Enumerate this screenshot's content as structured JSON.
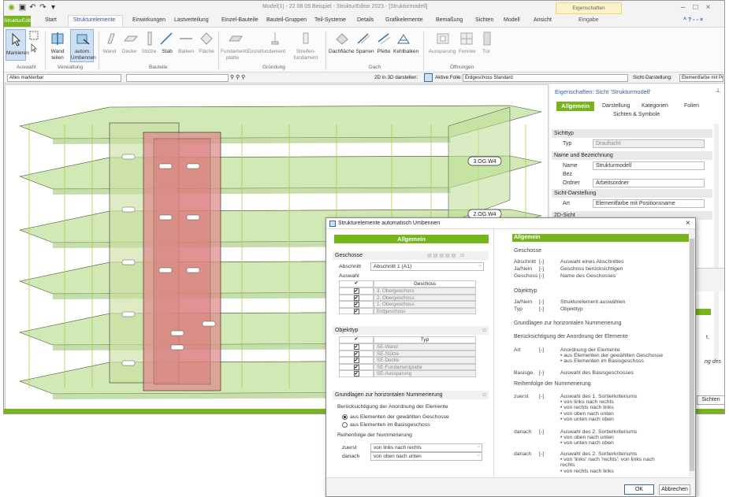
{
  "titlebar": {
    "title": "Model(1) - 22 08 09 Beispiel - StrukturEditor 2023 - [Strukturmodell]",
    "context_tab": "Eigenschaften",
    "context_sub": "Eingabe"
  },
  "app_button": "StrukturEditor",
  "tabs": [
    "Start",
    "Strukturelemente",
    "Einwirkungen",
    "Lastverteilung",
    "Einzel-Bauteile",
    "Bauteil-Gruppen",
    "Teil-Systeme",
    "Details",
    "Grafikelemente",
    "Bemaßung",
    "Sichten",
    "Modell",
    "Ansicht"
  ],
  "ribbon": {
    "auswahl": {
      "group": "Auswahl",
      "markieren": "Markieren"
    },
    "verwaltung": {
      "group": "Verwaltung",
      "wand_teilen": "Wand teilen",
      "umbenennen": "autom. Umbennen"
    },
    "bauteile": {
      "group": "Bauteile",
      "items": [
        "Wand",
        "Decke",
        "Stütze",
        "Stab",
        "Balken",
        "Fläche"
      ]
    },
    "gruendung": {
      "group": "Gründung",
      "items": [
        "Fundament-platte",
        "Einzelfundament",
        "Streifen-fundament"
      ]
    },
    "dach": {
      "group": "Dach",
      "items": [
        "Dachfläche",
        "Sparren",
        "Pfette",
        "Kehlbalken"
      ]
    },
    "oeffnungen": {
      "group": "Öffnungen",
      "items": [
        "Aussparung",
        "Fenster",
        "Tür"
      ]
    }
  },
  "toolbar2": {
    "filter": "Alles markierbar",
    "darstellen": "2D in 3D darstellen:",
    "aktive_folie": "Aktive Folie:",
    "folie_value": "Erdgeschoss  Standard",
    "sicht_label": "Sicht-Darstellung:",
    "sicht_value": "Elementfarbe mit Positions"
  },
  "viewport": {
    "labels": [
      "3.OG.W4",
      "2.OG.W4"
    ]
  },
  "props": {
    "title": "Eigenschaften: Sicht 'Strukturmodell'",
    "tabs": [
      "Allgemein",
      "Darstellung",
      "Kategorien",
      "Folien",
      "Sichten & Symbole"
    ],
    "sichttyp": {
      "section": "Sichttyp",
      "typ_label": "Typ",
      "typ_value": "Draufsicht"
    },
    "name": {
      "section": "Name und Bezeichnung",
      "name_label": "Name",
      "name_value": "Strukturmodell",
      "bez_label": "Bez",
      "ordner_label": "Ordner",
      "ordner_value": "Arbeitsordner"
    },
    "sicht": {
      "section": "Sicht-Darstellung",
      "art_label": "Art",
      "art_value": "Elementfarbe mit Positionsname"
    },
    "sicht2d": "2D-Sicht",
    "overflow": [
      "Sichten",
      "t,",
      "ng des"
    ]
  },
  "dialog": {
    "title": "Strukturelemente automatisch Umbennen",
    "tab": "Allgemein",
    "geschosse": {
      "section": "Geschosse",
      "abschnitt_label": "Abschnitt",
      "abschnitt_value": "Abschnitt 1 (A1)",
      "auswahl_label": "Auswahl",
      "col": "Geschoss",
      "rows": [
        "3. Obergeschoss",
        "2. Obergeschoss",
        "1. Obergeschoss",
        "Erdgeschoss"
      ]
    },
    "objekttyp": {
      "section": "Objekttyp",
      "col": "Typ",
      "rows": [
        "SE-Wand",
        "SE-Stütze",
        "SE-Decke",
        "SE-Fundamentplatte",
        "SE-Aussparung"
      ]
    },
    "nummerierung": {
      "section": "Grundlagen zur horizontalen Nummerierung",
      "anordnung_label": "Berücksichtigung der Anordnung der Elemente",
      "radio1": "aus Elementen der gewählten Geschosse",
      "radio2": "aus Elementen im Basisgeschoss",
      "reihenfolge_label": "Reihenfolge der Nummerierung",
      "zuerst_label": "zuerst",
      "zuerst_value": "von links nach rechts",
      "danach_label": "danach",
      "danach_value": "von oben nach unten"
    },
    "help": {
      "header": "Allgemein",
      "geschosse": "Geschosse",
      "g_rows": [
        [
          "Abschnitt",
          "[-]",
          "Auswahl eines Abschnittes"
        ],
        [
          "Ja/Nein",
          "[-]",
          "Geschoss berücksichtigen"
        ],
        [
          "Geschoss",
          "[-]",
          "Name des Geschosses"
        ]
      ],
      "objekttyp": "Objekttyp",
      "o_rows": [
        [
          "Ja/Nein",
          "[-]",
          "Strukturelement auswählen"
        ],
        [
          "Typ",
          "[-]",
          "Objekttyp"
        ]
      ],
      "grundlagen": "Grundlagen zur horizontalen Nummerierung",
      "beruecksichtigung": "Berücksichtigung der Anordnung der Elemente",
      "art_label": "Art",
      "art_unit": "[-]",
      "art_text": [
        "Anordnung der Elemente",
        "• aus Elementen der gewählten Geschosse",
        "• aus Elementen im Basisgeschoss"
      ],
      "basis_label": "Basisge.",
      "basis_unit": "[-]",
      "basis_text": "Auswahl des Basisgeschosses",
      "reihenfolge": "Reihenfolge der Nummerierung",
      "zuerst_label": "zuerst",
      "zuerst_unit": "[-]",
      "zuerst_text": [
        "Auswahl des 1. Sortierkriteriums",
        "• von links nach rechts",
        "• von rechts nach links",
        "• von oben nach unten",
        "• von unten nach oben"
      ],
      "danach1_label": "danach",
      "danach1_unit": "[-]",
      "danach1_text": [
        "Auswahl des 2. Sortierkriteriums",
        "• von oben nach unten",
        "• von unten nach oben"
      ],
      "danach2_label": "danach",
      "danach2_unit": "[-]",
      "danach2_text": [
        "Auswahl des 2. Sortierkriteriums",
        "• von 'links' nach 'rechts': von links nach",
        "rechts",
        "• von rechts nach links"
      ]
    },
    "ok": "OK",
    "cancel": "Abbrechen"
  },
  "colors": {
    "green": "#77b51d",
    "accent": "#2f5f9f",
    "slab": "#b9dc8c",
    "pink": "#e49a9a"
  }
}
